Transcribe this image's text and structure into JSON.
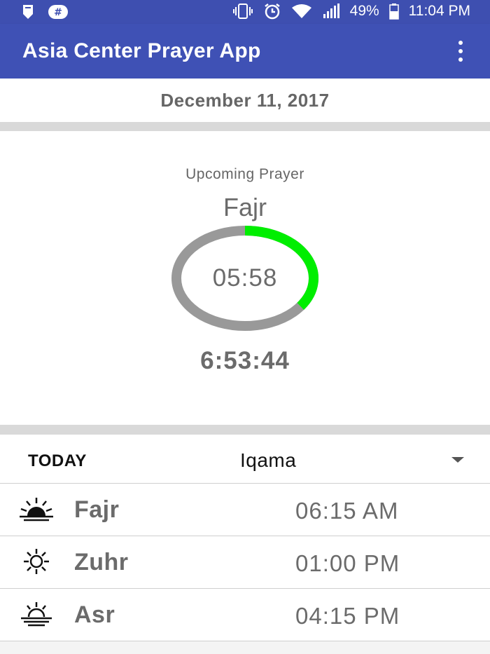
{
  "status_bar": {
    "battery_pct": "49%",
    "time": "11:04 PM",
    "icons": [
      "notification-icon",
      "slack-icon",
      "vibrate-icon",
      "alarm-icon",
      "wifi-icon",
      "signal-icon",
      "battery-icon"
    ]
  },
  "app_bar": {
    "title": "Asia Center Prayer App",
    "overflow_icon": "more-vert-icon"
  },
  "date": "December 11, 2017",
  "upcoming": {
    "label": "Upcoming Prayer",
    "prayer_name": "Fajr",
    "prayer_time": "05:58",
    "countdown": "6:53:44",
    "progress_fraction": 0.35,
    "colors": {
      "progress": "#00ee00",
      "track": "#999999"
    }
  },
  "today": {
    "label": "TODAY",
    "selected_mode": "Iqama"
  },
  "prayers": [
    {
      "name": "Fajr",
      "time": "06:15 AM",
      "icon": "sunrise-icon"
    },
    {
      "name": "Zuhr",
      "time": "01:00 PM",
      "icon": "sun-icon"
    },
    {
      "name": "Asr",
      "time": "04:15 PM",
      "icon": "sunset-icon"
    }
  ],
  "colors": {
    "app_bar": "#3f51b5",
    "status_bar": "#3e4fb0",
    "text_grey": "#6b6b6b"
  }
}
